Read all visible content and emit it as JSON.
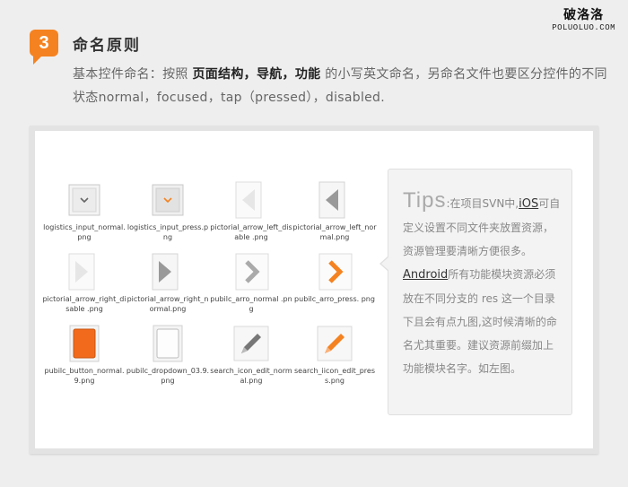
{
  "watermark": {
    "cn": "破洛洛",
    "en": "POLUOLUO.COM"
  },
  "section": {
    "number": "3",
    "title": "命名原则",
    "desc_pre": "基本控件命名：按照 ",
    "desc_bold": "页面结构，导航，功能",
    "desc_post": " 的小写英文命名，另命名文件也要区分控件的不同状态normal，focused，tap（pressed），disabled."
  },
  "icons": [
    {
      "caption": "logistics_input_normal.png",
      "icon": "dropdown-normal-icon"
    },
    {
      "caption": "logistics_input_press.png",
      "icon": "dropdown-pressed-icon"
    },
    {
      "caption": "pictorial_arrow_left_disable .png",
      "icon": "arrow-left-disabled-icon"
    },
    {
      "caption": "pictorial_arrow_left_normal.png",
      "icon": "arrow-left-normal-icon"
    },
    {
      "caption": "pictorial_arrow_right_disable .png",
      "icon": "arrow-right-disabled-icon"
    },
    {
      "caption": "pictorial_arrow_right_normal.png",
      "icon": "arrow-right-normal-icon"
    },
    {
      "caption": "pubilc_arro_normal .png",
      "icon": "chevron-right-gray-icon"
    },
    {
      "caption": "pubilc_arro_press. png",
      "icon": "chevron-right-orange-icon"
    },
    {
      "caption": "pubilc_button_normal.9.png",
      "icon": "orange-button-icon"
    },
    {
      "caption": "pubilc_dropdown_03.9.png",
      "icon": "dropdown-panel-icon"
    },
    {
      "caption": "search_icon_edit_normal.png",
      "icon": "pencil-gray-icon"
    },
    {
      "caption": "search_iicon_edit_press.png",
      "icon": "pencil-orange-icon"
    }
  ],
  "tips": {
    "heading": "Tips",
    "sep": ":",
    "t1": "在项目SVN中,",
    "ios": "iOS",
    "t2": "可自定义设置不同文件夹放置资源，资源管理要清晰方便很多。",
    "android": "Android",
    "t3": "所有功能模块资源必须放在不同分支的 res 这一个目录下且会有点九图,这时候清晰的命名尤其重要。建议资源前缀加上功能模块名字。如左图。"
  },
  "colors": {
    "accent": "#f58220",
    "background": "#eeeeee"
  }
}
